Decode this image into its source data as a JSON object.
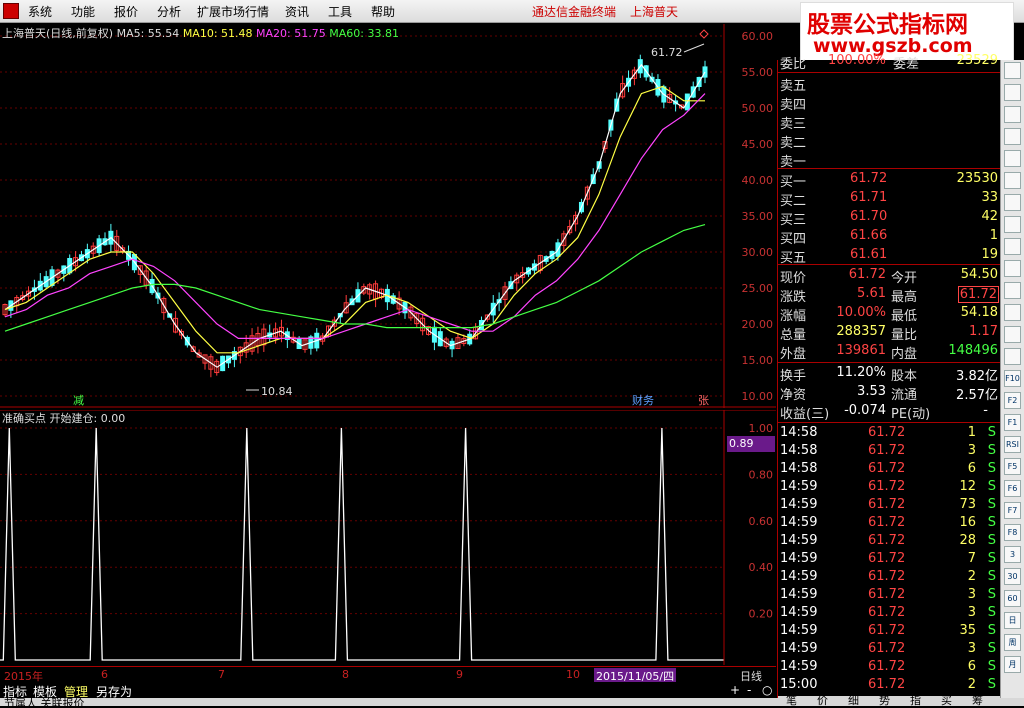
{
  "menu": {
    "items": [
      "系统",
      "功能",
      "报价",
      "分析",
      "扩展市场行情",
      "资讯",
      "工具",
      "帮助"
    ],
    "terminal": "通达信金融终端",
    "stock_name": "上海普天"
  },
  "banner": {
    "line1": "股票公式指标网",
    "line2": "www.gszb.com"
  },
  "chart_title": {
    "name": "上海普天(日线,前复权)",
    "ma5": "MA5: 55.54",
    "ma10": "MA10: 51.48",
    "ma20": "MA20: 51.75",
    "ma60": "MA60: 33.81"
  },
  "annotations": {
    "high": "61.72",
    "low": "10.84",
    "m1": "减",
    "m2": "财务",
    "m3": "张"
  },
  "indicator": {
    "title": "准确买点  开始建仓: 0.00",
    "current": "0.89"
  },
  "datebar": {
    "d1": "2015年",
    "d2": "6",
    "d3": "7",
    "d4": "8",
    "d5": "9",
    "d6": "10",
    "selected": "2015/11/05/四",
    "period": "日线"
  },
  "bottom_tabs": {
    "t1": "指标",
    "t2": "模板",
    "t3": "管理",
    "t4": "另存为",
    "plus": "+",
    "minus": "-",
    "circle": "○"
  },
  "status": {
    "s1": "节属人 关联报价"
  },
  "quote": {
    "top_partial": {
      "l1": "委比",
      "v1": "100.00%",
      "l2": "委差",
      "v2": "23529"
    },
    "sell": [
      {
        "label": "卖五"
      },
      {
        "label": "卖四"
      },
      {
        "label": "卖三"
      },
      {
        "label": "卖二"
      },
      {
        "label": "卖一"
      }
    ],
    "buy": [
      {
        "label": "买一",
        "price": "61.72",
        "vol": "23530"
      },
      {
        "label": "买二",
        "price": "61.71",
        "vol": "33"
      },
      {
        "label": "买三",
        "price": "61.70",
        "vol": "42"
      },
      {
        "label": "买四",
        "price": "61.66",
        "vol": "1"
      },
      {
        "label": "买五",
        "price": "61.61",
        "vol": "19"
      }
    ],
    "stats": {
      "xj_l": "现价",
      "xj_v": "61.72",
      "jk_l": "今开",
      "jk_v": "54.50",
      "zd_l": "涨跌",
      "zd_v": "5.61",
      "zg_l": "最高",
      "zg_v": "61.72",
      "zf_l": "涨幅",
      "zf_v": "10.00%",
      "zd2_l": "最低",
      "zd2_v": "54.18",
      "zl_l": "总量",
      "zl_v": "288357",
      "lb_l": "量比",
      "lb_v": "1.17",
      "wp_l": "外盘",
      "wp_v": "139861",
      "np_l": "内盘",
      "np_v": "148496",
      "hs_l": "换手",
      "hs_v": "11.20%",
      "gb_l": "股本",
      "gb_v": "3.82亿",
      "jz_l": "净资",
      "jz_v": "3.53",
      "lt_l": "流通",
      "lt_v": "2.57亿",
      "sy_l": "收益(三)",
      "sy_v": "-0.074",
      "pe_l": "PE(动)",
      "pe_v": "-"
    },
    "ticks": [
      {
        "time": "14:58",
        "price": "61.72",
        "vol": "1",
        "flag": "S"
      },
      {
        "time": "14:58",
        "price": "61.72",
        "vol": "3",
        "flag": "S"
      },
      {
        "time": "14:58",
        "price": "61.72",
        "vol": "6",
        "flag": "S"
      },
      {
        "time": "14:59",
        "price": "61.72",
        "vol": "12",
        "flag": "S"
      },
      {
        "time": "14:59",
        "price": "61.72",
        "vol": "73",
        "flag": "S"
      },
      {
        "time": "14:59",
        "price": "61.72",
        "vol": "16",
        "flag": "S"
      },
      {
        "time": "14:59",
        "price": "61.72",
        "vol": "28",
        "flag": "S"
      },
      {
        "time": "14:59",
        "price": "61.72",
        "vol": "7",
        "flag": "S"
      },
      {
        "time": "14:59",
        "price": "61.72",
        "vol": "2",
        "flag": "S"
      },
      {
        "time": "14:59",
        "price": "61.72",
        "vol": "3",
        "flag": "S"
      },
      {
        "time": "14:59",
        "price": "61.72",
        "vol": "3",
        "flag": "S"
      },
      {
        "time": "14:59",
        "price": "61.72",
        "vol": "35",
        "flag": "S"
      },
      {
        "time": "14:59",
        "price": "61.72",
        "vol": "3",
        "flag": "S"
      },
      {
        "time": "14:59",
        "price": "61.72",
        "vol": "6",
        "flag": "S"
      },
      {
        "time": "15:00",
        "price": "61.72",
        "vol": "2",
        "flag": "S"
      }
    ],
    "bottom_tabs": [
      "笔",
      "价",
      "细",
      "势",
      "指",
      "买",
      "筹"
    ]
  },
  "toolbar": [
    "F10",
    "F2",
    "F1",
    "RSI",
    "F5",
    "F6",
    "F7",
    "F8",
    "3",
    "30",
    "60",
    "日",
    "周",
    "月"
  ],
  "chart_data": [
    {
      "type": "candlestick",
      "title": "上海普天(日线,前复权)",
      "ylim": [
        10,
        60
      ],
      "yticks": [
        "60.00",
        "55.00",
        "50.00",
        "45.00",
        "40.00",
        "35.00",
        "30.00",
        "25.00",
        "20.00",
        "15.00",
        "10.00"
      ],
      "x": [
        "2015年",
        "6",
        "7",
        "8",
        "9",
        "10",
        "2015/11/05/四"
      ],
      "series": [
        {
          "name": "MA5",
          "color": "#ffffff",
          "values": [
            22,
            24,
            26,
            28,
            30,
            32,
            29,
            25,
            20,
            16,
            14,
            16,
            18,
            19,
            17,
            18,
            22,
            25,
            24,
            22,
            19,
            17,
            18,
            22,
            26,
            28,
            30,
            35,
            42,
            52,
            56,
            52,
            50,
            55
          ]
        },
        {
          "name": "MA10",
          "color": "#ffff44",
          "values": [
            22,
            23,
            25,
            27,
            29,
            30,
            30,
            27,
            23,
            19,
            16,
            16,
            17,
            18,
            18,
            18,
            20,
            23,
            24,
            23,
            21,
            19,
            18,
            20,
            24,
            27,
            29,
            32,
            38,
            46,
            52,
            53,
            51,
            51
          ]
        },
        {
          "name": "MA20",
          "color": "#ff44ff",
          "values": [
            21,
            22,
            24,
            25,
            27,
            28,
            29,
            28,
            26,
            23,
            20,
            18,
            18,
            18,
            18,
            18,
            19,
            20,
            21,
            22,
            21,
            20,
            19,
            19,
            21,
            24,
            26,
            29,
            33,
            38,
            43,
            47,
            49,
            52
          ]
        },
        {
          "name": "MA60",
          "color": "#44ff44",
          "values": [
            19,
            20,
            21,
            22,
            23,
            24,
            25,
            25.5,
            25.5,
            25,
            24,
            23,
            22,
            21.5,
            21,
            20.5,
            20,
            20,
            19.5,
            19.5,
            19.5,
            19.5,
            19.5,
            20,
            21,
            22,
            23,
            24.5,
            26,
            28,
            30,
            31.5,
            33,
            33.8
          ]
        }
      ],
      "annotations": {
        "high": 61.72,
        "low": 10.84
      }
    },
    {
      "type": "line",
      "title": "准确买点",
      "ylim": [
        0,
        1
      ],
      "yticks": [
        "1.00",
        "0.80",
        "0.60",
        "0.40",
        "0.20"
      ],
      "series": [
        {
          "name": "开始建仓",
          "spikes_at": [
            0.012,
            0.124,
            0.318,
            0.44,
            0.6,
            0.853
          ],
          "peak": 1.0
        }
      ],
      "current": 0.89
    }
  ]
}
